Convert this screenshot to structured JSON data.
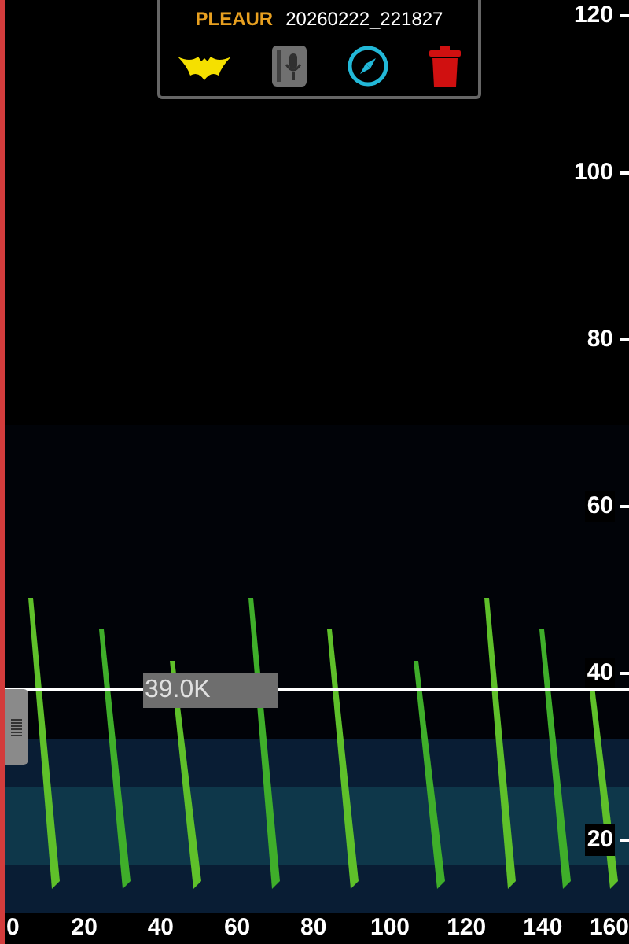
{
  "recording": {
    "species": "PLEAUR",
    "file": "20260222_221827"
  },
  "cursor": {
    "label": "39.0K"
  },
  "y_axis": {
    "ticks": [
      "120",
      "100",
      "80",
      "60",
      "40",
      "20"
    ]
  },
  "x_axis": {
    "ticks": [
      "0",
      "20",
      "40",
      "60",
      "80",
      "100",
      "120",
      "140",
      "160"
    ]
  }
}
